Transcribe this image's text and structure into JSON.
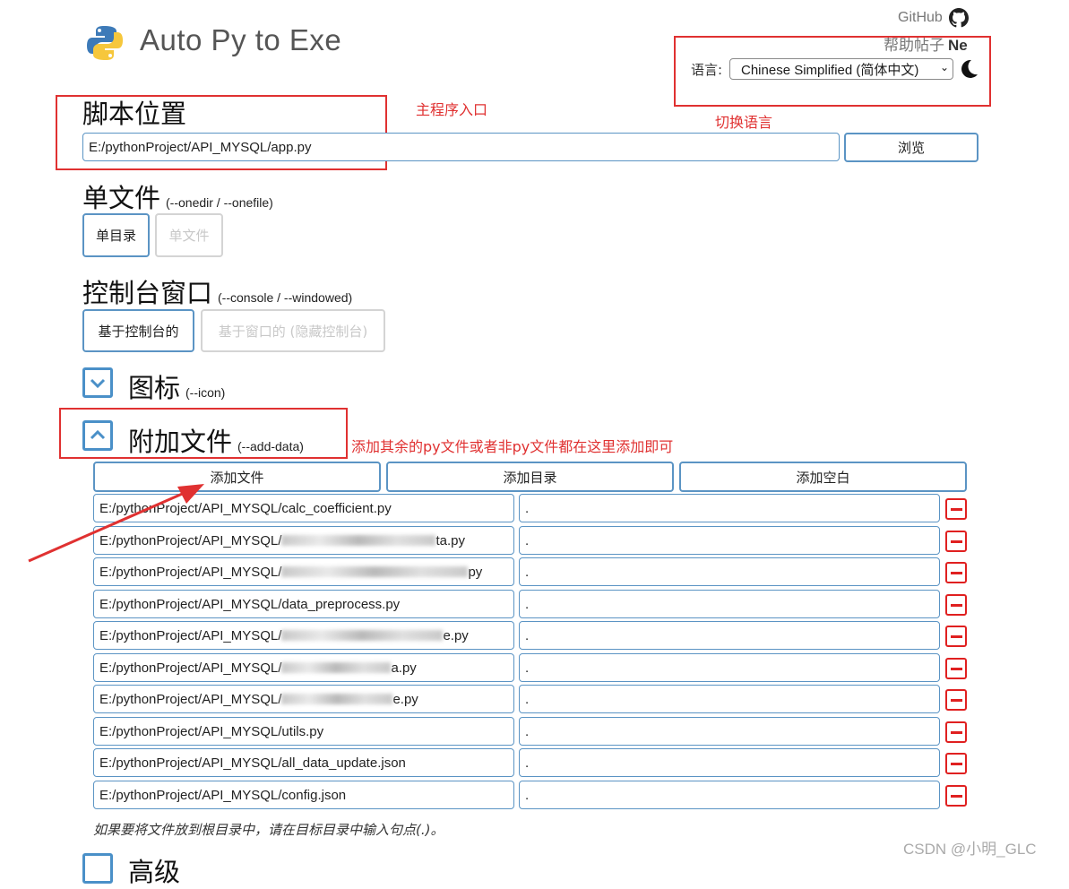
{
  "header": {
    "title": "Auto Py to Exe",
    "github_label": "GitHub",
    "help_label": "帮助帖子",
    "help_extra": "Ne",
    "language_label": "语言:",
    "language_value": "Chinese Simplified (简体中文)"
  },
  "annotations": {
    "main_entry": "主程序入口",
    "switch_language": "切换语言",
    "add_data_note": "添加其余的py文件或者非py文件都在这里添加即可"
  },
  "script": {
    "heading": "脚本位置",
    "path_value": "E:/pythonProject/API_MYSQL/app.py",
    "browse_label": "浏览"
  },
  "onefile": {
    "heading": "单文件",
    "flag": "(--onedir / --onefile)",
    "option_dir": "单目录",
    "option_file": "单文件"
  },
  "console": {
    "heading": "控制台窗口",
    "flag": "(--console / --windowed)",
    "option_console": "基于控制台的",
    "option_windowed": "基于窗口的 (隐藏控制台)"
  },
  "icon_section": {
    "heading": "图标",
    "flag": "(--icon)"
  },
  "add_data": {
    "heading": "附加文件",
    "flag": "(--add-data)",
    "add_file_label": "添加文件",
    "add_folder_label": "添加目录",
    "add_blank_label": "添加空白",
    "rows": [
      {
        "src": "E:/pythonProject/API_MYSQL/calc_coefficient.py",
        "dest": "."
      },
      {
        "src_prefix": "E:/pythonProject/API_MYSQL/",
        "src_suffix": "ta.py",
        "dest": "."
      },
      {
        "src_prefix": "E:/pythonProject/API_MYSQL/",
        "src_suffix": "py",
        "dest": "."
      },
      {
        "src": "E:/pythonProject/API_MYSQL/data_preprocess.py",
        "dest": "."
      },
      {
        "src_prefix": "E:/pythonProject/API_MYSQL/",
        "src_suffix": "e.py",
        "dest": "."
      },
      {
        "src_prefix": "E:/pythonProject/API_MYSQL/",
        "src_suffix": "a.py",
        "dest": "."
      },
      {
        "src_prefix": "E:/pythonProject/API_MYSQL/",
        "src_suffix": "e.py",
        "dest": "."
      },
      {
        "src": "E:/pythonProject/API_MYSQL/utils.py",
        "dest": "."
      },
      {
        "src": "E:/pythonProject/API_MYSQL/all_data_update.json",
        "dest": "."
      },
      {
        "src": "E:/pythonProject/API_MYSQL/config.json",
        "dest": "."
      }
    ],
    "hint": "如果要将文件放到根目录中，请在目标目录中输入句点(.)。"
  },
  "next_section_heading": "高级",
  "watermark": "CSDN @小明_GLC",
  "colors": {
    "accent": "#5b94c4",
    "annotation_red": "#e03131",
    "remove_red": "#e02020"
  }
}
